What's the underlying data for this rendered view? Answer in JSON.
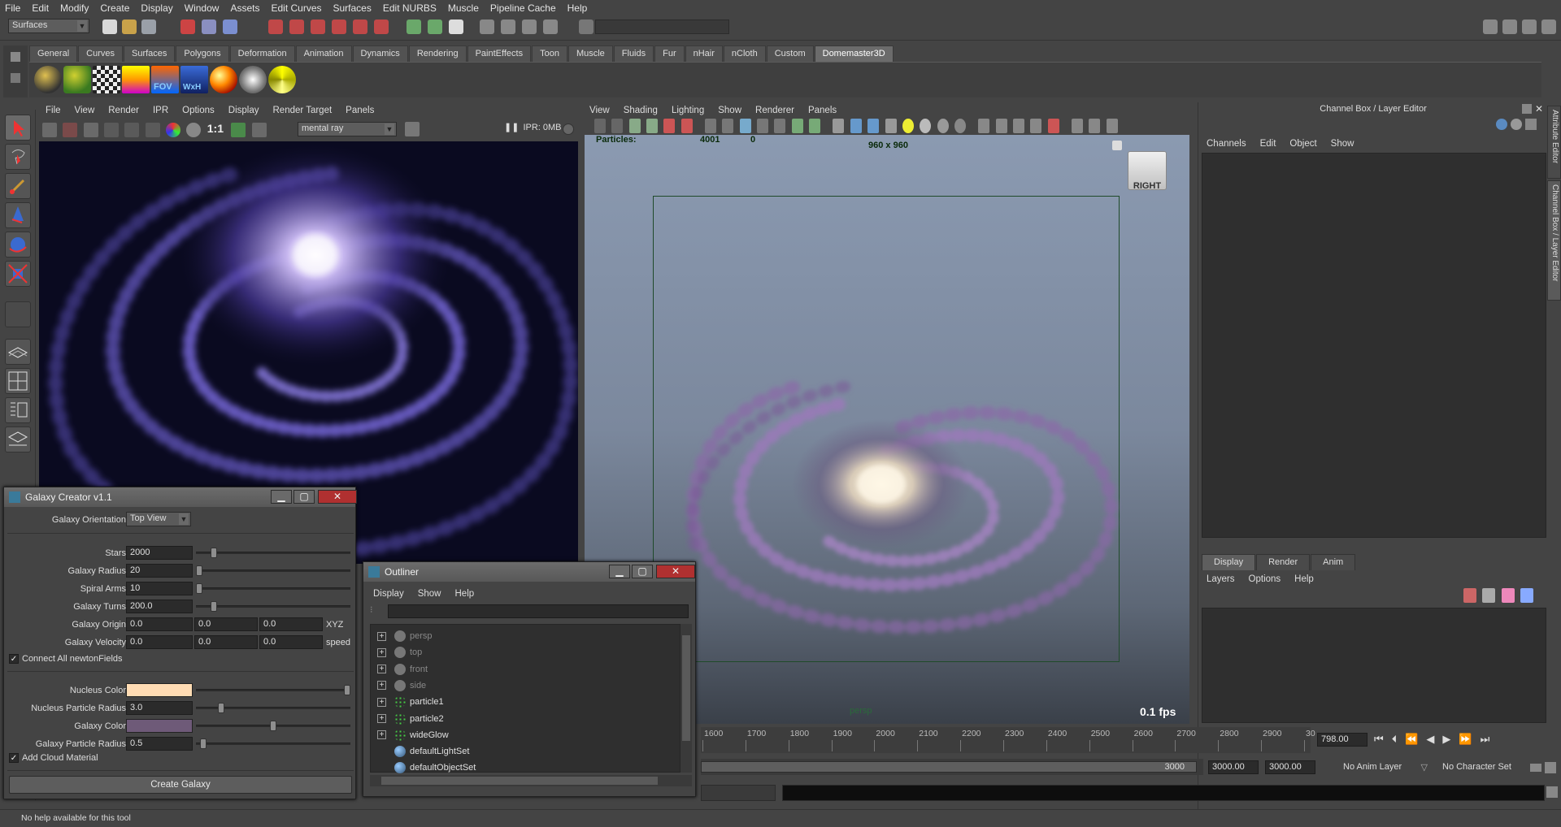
{
  "menu": [
    "File",
    "Edit",
    "Modify",
    "Create",
    "Display",
    "Window",
    "Assets",
    "Edit Curves",
    "Surfaces",
    "Edit NURBS",
    "Muscle",
    "Pipeline Cache",
    "Help"
  ],
  "status": {
    "module": "Surfaces"
  },
  "shelf": {
    "tabs": [
      "General",
      "Curves",
      "Surfaces",
      "Polygons",
      "Deformation",
      "Animation",
      "Dynamics",
      "Rendering",
      "PaintEffects",
      "Toon",
      "Muscle",
      "Fluids",
      "Fur",
      "nHair",
      "nCloth",
      "Custom",
      "Domemaster3D"
    ],
    "active_tab": "Domemaster3D",
    "icon_labels": {
      "fov": "FOV",
      "wxh": "WxH"
    }
  },
  "render_view": {
    "menu": [
      "File",
      "View",
      "Render",
      "IPR",
      "Options",
      "Display",
      "Render Target",
      "Panels"
    ],
    "ratio": "1:1",
    "renderer": "mental ray",
    "ipr_status": "IPR: 0MB"
  },
  "viewport": {
    "menu": [
      "View",
      "Shading",
      "Lighting",
      "Show",
      "Renderer",
      "Panels"
    ],
    "particles_label": "Particles:",
    "particles_count": "4001",
    "particles_selected": "0",
    "resolution": "960 x 960",
    "view_cube": "RIGHT",
    "camera_label": "persp",
    "fps": "0.1 fps"
  },
  "channel_box": {
    "title": "Channel Box / Layer Editor",
    "menu": [
      "Channels",
      "Edit",
      "Object",
      "Show"
    ],
    "side_tabs": [
      "Attribute Editor",
      "Channel Box / Layer Editor"
    ],
    "layer_tabs": [
      "Display",
      "Render",
      "Anim"
    ],
    "active_layer_tab": "Display",
    "layer_menu": [
      "Layers",
      "Options",
      "Help"
    ]
  },
  "galaxy": {
    "title": "Galaxy Creator v1.1",
    "orientation_label": "Galaxy Orientation",
    "orientation_value": "Top View",
    "stars_label": "Stars",
    "stars": "2000",
    "radius_label": "Galaxy Radius",
    "radius": "20",
    "arms_label": "Spiral Arms",
    "arms": "10",
    "turns_label": "Galaxy Turns",
    "turns": "200.0",
    "origin_label": "Galaxy Origin",
    "origin": [
      "0.0",
      "0.0",
      "0.0"
    ],
    "origin_suffix": "XYZ",
    "velocity_label": "Galaxy Velocity",
    "velocity": [
      "0.0",
      "0.0",
      "0.0"
    ],
    "velocity_suffix": "speed",
    "connect_label": "Connect All newtonFields",
    "nucleus_color_label": "Nucleus Color",
    "nucleus_color": "#ffdcb4",
    "nucleus_radius_label": "Nucleus Particle Radius",
    "nucleus_radius": "3.0",
    "galaxy_color_label": "Galaxy Color",
    "galaxy_color": "#6e5a78",
    "particle_radius_label": "Galaxy Particle Radius",
    "particle_radius": "0.5",
    "cloud_label": "Add Cloud Material",
    "create_button": "Create Galaxy",
    "slider_levels": {
      "stars": 0.1,
      "radius": 0.0,
      "arms": 0.0,
      "turns": 0.1,
      "nucleus_color": 1.0,
      "nucleus_radius": 0.15,
      "galaxy_color": 0.5,
      "particle_radius": 0.03
    }
  },
  "outliner": {
    "title": "Outliner",
    "menu": [
      "Display",
      "Show",
      "Help"
    ],
    "items": [
      {
        "name": "persp",
        "type": "camera",
        "dim": true
      },
      {
        "name": "top",
        "type": "camera",
        "dim": true
      },
      {
        "name": "front",
        "type": "camera",
        "dim": true
      },
      {
        "name": "side",
        "type": "camera",
        "dim": true
      },
      {
        "name": "particle1",
        "type": "particle",
        "dim": false
      },
      {
        "name": "particle2",
        "type": "particle",
        "dim": false
      },
      {
        "name": "wideGlow",
        "type": "particle",
        "dim": false
      },
      {
        "name": "defaultLightSet",
        "type": "set",
        "dim": false
      },
      {
        "name": "defaultObjectSet",
        "type": "set",
        "dim": false
      }
    ]
  },
  "timeline": {
    "ticks": [
      "1600",
      "1700",
      "1800",
      "1900",
      "2000",
      "2100",
      "2200",
      "2300",
      "2400",
      "2500",
      "2600",
      "2700",
      "2800",
      "2900",
      "30"
    ],
    "current_frame": "798.00",
    "range_end": "3000",
    "start": "3000.00",
    "end": "3000.00",
    "anim_layer": "No Anim Layer",
    "character_set": "No Character Set"
  },
  "help_line": "No help available for this tool",
  "colors": {
    "accent": "#6b6b6b",
    "close": "#b03030",
    "viewport_top": "#8b9ab1"
  }
}
